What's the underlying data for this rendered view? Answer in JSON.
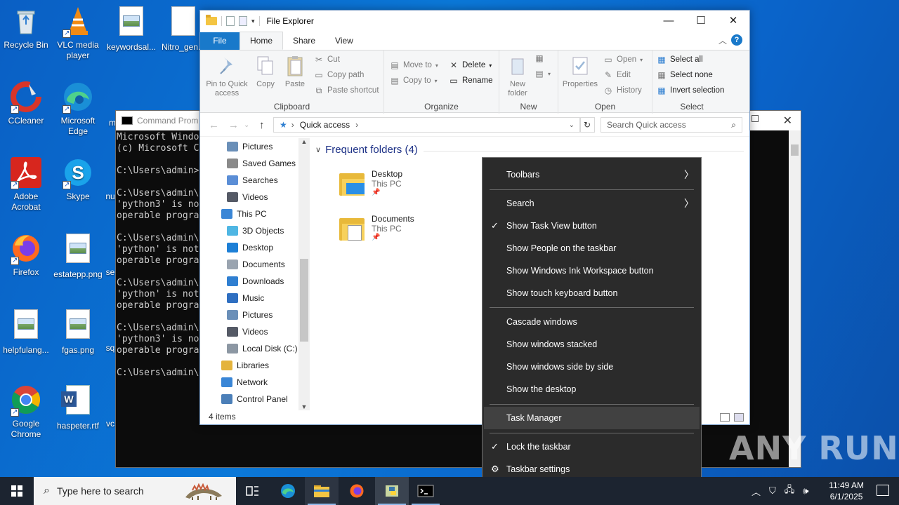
{
  "desktop": {
    "icons": [
      {
        "label": "Recycle Bin",
        "icon": "recycle-bin-icon"
      },
      {
        "label": "VLC media player",
        "icon": "vlc-icon"
      },
      {
        "label": "keywordsal...",
        "icon": "image-file-icon"
      },
      {
        "label": "Nitro_gen...",
        "icon": "file-icon"
      },
      {
        "label": "CCleaner",
        "icon": "ccleaner-icon"
      },
      {
        "label": "Microsoft Edge",
        "icon": "edge-icon"
      },
      {
        "label": "m",
        "icon": "image-file-icon"
      },
      {
        "label": "Adobe Acrobat",
        "icon": "acrobat-icon"
      },
      {
        "label": "Skype",
        "icon": "skype-icon"
      },
      {
        "label": "nu",
        "icon": "image-file-icon"
      },
      {
        "label": "Firefox",
        "icon": "firefox-icon"
      },
      {
        "label": "estatepp.png",
        "icon": "image-file-icon"
      },
      {
        "label": "se",
        "icon": "image-file-icon"
      },
      {
        "label": "helpfulang...",
        "icon": "image-file-icon"
      },
      {
        "label": "fgas.png",
        "icon": "image-file-icon"
      },
      {
        "label": "sq",
        "icon": "image-file-icon"
      },
      {
        "label": "Google Chrome",
        "icon": "chrome-icon"
      },
      {
        "label": "haspeter.rtf",
        "icon": "word-file-icon"
      },
      {
        "label": "vc",
        "icon": "file-icon"
      }
    ]
  },
  "cmd": {
    "title": "Command Prom",
    "lines": "Microsoft Windo\n(c) Microsoft C\n\nC:\\Users\\admin>\n\nC:\\Users\\admin\\\n'python3' is no\noperable progra\n\nC:\\Users\\admin\\\n'python' is not\noperable progra\n\nC:\\Users\\admin\\\n'python' is not\noperable progra\n\nC:\\Users\\admin\\\n'python3' is no\noperable progra\n\nC:\\Users\\admin\\"
  },
  "explorer": {
    "title": "File Explorer",
    "tabs": {
      "file": "File",
      "home": "Home",
      "share": "Share",
      "view": "View"
    },
    "clipboard": {
      "pin": "Pin to Quick access",
      "copy": "Copy",
      "paste": "Paste",
      "cut": "Cut",
      "copy_path": "Copy path",
      "paste_shortcut": "Paste shortcut",
      "group": "Clipboard"
    },
    "organize": {
      "move_to": "Move to",
      "copy_to": "Copy to",
      "delete": "Delete",
      "rename": "Rename",
      "group": "Organize"
    },
    "new": {
      "new_folder": "New folder",
      "group": "New"
    },
    "open": {
      "properties": "Properties",
      "open": "Open",
      "edit": "Edit",
      "history": "History",
      "group": "Open"
    },
    "select": {
      "select_all": "Select all",
      "select_none": "Select none",
      "invert": "Invert selection",
      "group": "Select"
    },
    "address": "Quick access",
    "search_placeholder": "Search Quick access",
    "nav": [
      {
        "label": "Pictures",
        "indent": 1,
        "color": "#6a8fb8"
      },
      {
        "label": "Saved Games",
        "indent": 1,
        "color": "#8a8a8a"
      },
      {
        "label": "Searches",
        "indent": 1,
        "color": "#5b8ed6"
      },
      {
        "label": "Videos",
        "indent": 1,
        "color": "#555a66"
      },
      {
        "label": "This PC",
        "indent": 0,
        "color": "#3a86d6"
      },
      {
        "label": "3D Objects",
        "indent": 1,
        "color": "#4fb6e3"
      },
      {
        "label": "Desktop",
        "indent": 1,
        "color": "#1d7fd6"
      },
      {
        "label": "Documents",
        "indent": 1,
        "color": "#9aa4b0"
      },
      {
        "label": "Downloads",
        "indent": 1,
        "color": "#2f7fd1"
      },
      {
        "label": "Music",
        "indent": 1,
        "color": "#2f6fc1"
      },
      {
        "label": "Pictures",
        "indent": 1,
        "color": "#6a8fb8"
      },
      {
        "label": "Videos",
        "indent": 1,
        "color": "#555a66"
      },
      {
        "label": "Local Disk (C:)",
        "indent": 1,
        "color": "#8c97a3"
      },
      {
        "label": "Libraries",
        "indent": 0,
        "color": "#e4b33c"
      },
      {
        "label": "Network",
        "indent": 0,
        "color": "#3a86d6"
      },
      {
        "label": "Control Panel",
        "indent": 0,
        "color": "#4b7fb8"
      }
    ],
    "section": "Frequent folders (4)",
    "folders": [
      {
        "name": "Desktop",
        "location": "This PC"
      },
      {
        "name": "Documents",
        "location": "This PC"
      }
    ],
    "status": "4 items"
  },
  "context_menu": {
    "items": [
      {
        "label": "Toolbars",
        "submenu": true
      },
      {
        "label": "Search",
        "submenu": true
      },
      {
        "label": "Show Task View button",
        "checked": true
      },
      {
        "label": "Show People on the taskbar"
      },
      {
        "label": "Show Windows Ink Workspace button"
      },
      {
        "label": "Show touch keyboard button"
      },
      {
        "label": "Cascade windows"
      },
      {
        "label": "Show windows stacked"
      },
      {
        "label": "Show windows side by side"
      },
      {
        "label": "Show the desktop"
      },
      {
        "label": "Task Manager",
        "hovered": true
      },
      {
        "label": "Lock the taskbar",
        "checked": true
      },
      {
        "label": "Taskbar settings",
        "icon": "gear-icon"
      }
    ]
  },
  "taskbar": {
    "search_placeholder": "Type here to search",
    "time": "11:49 AM",
    "date": "6/1/2025"
  },
  "watermark": "ANY RUN"
}
